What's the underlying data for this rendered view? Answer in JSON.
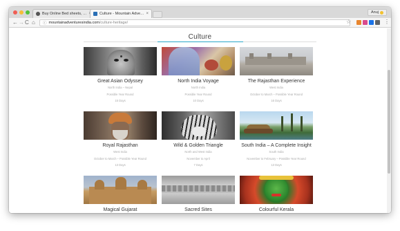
{
  "browser": {
    "tabs": [
      {
        "label": "Buy Online Bed sheets, Pillo…",
        "close": "×"
      },
      {
        "label": "Culture - Mountain Adventure…",
        "close": "×"
      }
    ],
    "user": "Anuj",
    "address": {
      "domain": "mountainadventuresindia.com",
      "path": "/culture-heritage/"
    },
    "nav": {
      "back": "←",
      "forward": "→",
      "reload": "C",
      "home": "⌂"
    },
    "star": "☆",
    "menu": "⋮"
  },
  "page": {
    "title": "Culture",
    "accent_color": "#2aa7c9"
  },
  "tours": [
    {
      "name": "Great Asian Odyssey",
      "line1": "North India – Nepal",
      "line2": "Possible Year Round",
      "line3": "15 Days"
    },
    {
      "name": "North India Voyage",
      "line1": "North India",
      "line2": "Possible Year Round",
      "line3": "10 Days"
    },
    {
      "name": "The Rajasthan Experience",
      "line1": "West India",
      "line2": "October to March – Possible Year Round",
      "line3": "16 Days"
    },
    {
      "name": "Royal Rajasthan",
      "line1": "West India",
      "line2": "October to March – Possible Year Round",
      "line3": "13 Days"
    },
    {
      "name": "Wild & Golden Triangle",
      "line1": "North and West India",
      "line2": "November to April",
      "line3": "7 Days"
    },
    {
      "name": "South India – A Complete Insight",
      "line1": "South India",
      "line2": "November to February – Possible Year Round",
      "line3": "13 Days"
    },
    {
      "name": "Magical Gujarat",
      "line1": "",
      "line2": "",
      "line3": ""
    },
    {
      "name": "Sacred Sites",
      "line1": "",
      "line2": "",
      "line3": ""
    },
    {
      "name": "Colourful Kerala",
      "line1": "",
      "line2": "",
      "line3": ""
    }
  ]
}
